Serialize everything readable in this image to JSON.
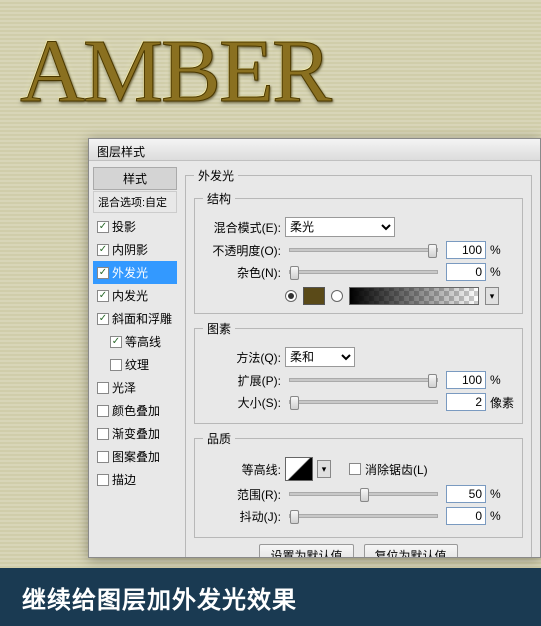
{
  "amber_text": "AMBER",
  "dialog": {
    "title": "图层样式"
  },
  "sidebar": {
    "header": "样式",
    "sub": "混合选项:自定",
    "items": [
      {
        "label": "投影",
        "checked": true
      },
      {
        "label": "内阴影",
        "checked": true
      },
      {
        "label": "外发光",
        "checked": true,
        "selected": true
      },
      {
        "label": "内发光",
        "checked": true
      },
      {
        "label": "斜面和浮雕",
        "checked": true
      },
      {
        "label": "等高线",
        "checked": true,
        "indent": true
      },
      {
        "label": "纹理",
        "checked": false,
        "indent": true
      },
      {
        "label": "光泽",
        "checked": false
      },
      {
        "label": "颜色叠加",
        "checked": false
      },
      {
        "label": "渐变叠加",
        "checked": false
      },
      {
        "label": "图案叠加",
        "checked": false
      },
      {
        "label": "描边",
        "checked": false
      }
    ]
  },
  "panel": {
    "title": "外发光",
    "structure": {
      "legend": "结构",
      "blend_label": "混合模式(E):",
      "blend_value": "柔光",
      "opacity_label": "不透明度(O):",
      "opacity_value": "100",
      "noise_label": "杂色(N):",
      "noise_value": "0",
      "percent": "%"
    },
    "element": {
      "legend": "图素",
      "method_label": "方法(Q):",
      "method_value": "柔和",
      "spread_label": "扩展(P):",
      "spread_value": "100",
      "size_label": "大小(S):",
      "size_value": "2",
      "size_unit": "像素",
      "percent": "%"
    },
    "quality": {
      "legend": "品质",
      "contour_label": "等高线:",
      "antialias_label": "消除锯齿(L)",
      "range_label": "范围(R):",
      "range_value": "50",
      "jitter_label": "抖动(J):",
      "jitter_value": "0",
      "percent": "%"
    },
    "buttons": {
      "set_default": "设置为默认值",
      "reset_default": "复位为默认值"
    }
  },
  "caption": "继续给图层加外发光效果"
}
